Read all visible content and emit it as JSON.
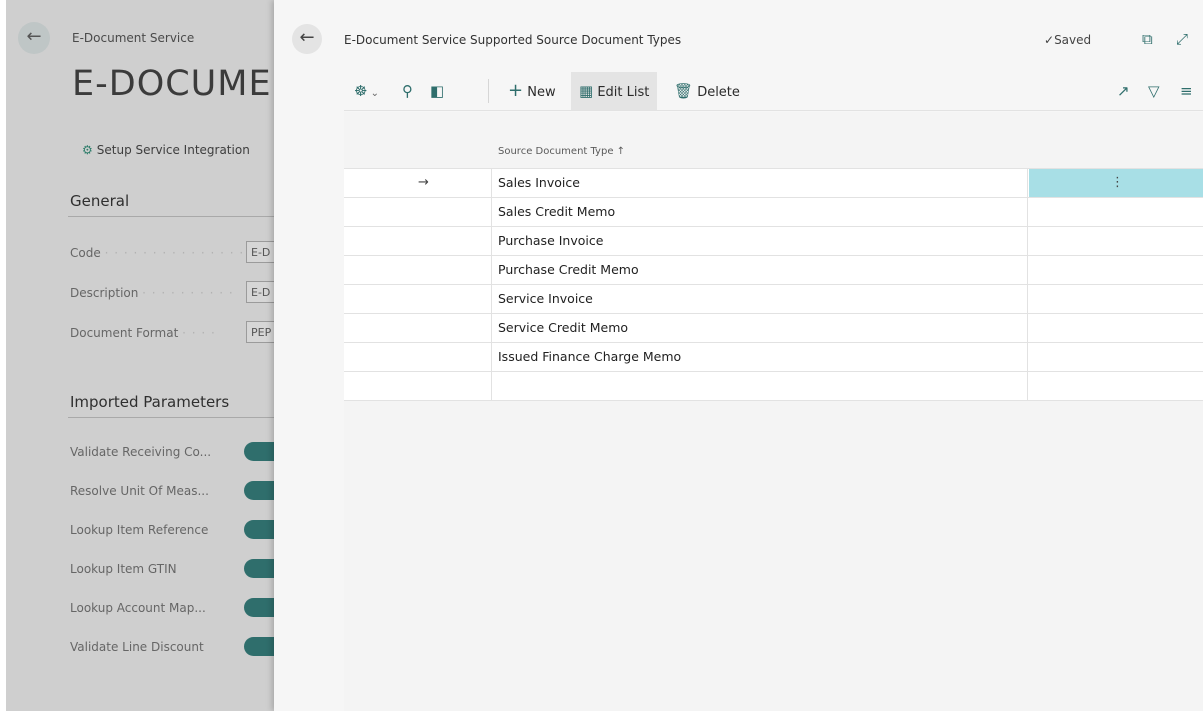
{
  "background": {
    "caption": "E-Document Service",
    "title": "E-DOCUME",
    "action": "Setup Service Integration",
    "sections": {
      "general": "General",
      "imported": "Imported Parameters"
    },
    "fields": [
      {
        "label": "Code",
        "value": "E-D"
      },
      {
        "label": "Description",
        "value": "E-D"
      },
      {
        "label": "Document Format",
        "value": "PEP"
      }
    ],
    "toggles": [
      "Validate Receiving Co...",
      "Resolve Unit Of Meas...",
      "Lookup Item Reference",
      "Lookup Item GTIN",
      "Lookup Account Map...",
      "Validate Line Discount"
    ]
  },
  "dialog": {
    "title": "E-Document Service Supported Source Document Types",
    "saved": "Saved",
    "toolbar": {
      "new": "New",
      "edit_list": "Edit List",
      "delete": "Delete"
    },
    "column_header": "Source Document Type",
    "rows": [
      "Sales Invoice",
      "Sales Credit Memo",
      "Purchase Invoice",
      "Purchase Credit Memo",
      "Service Invoice",
      "Service Credit Memo",
      "Issued Finance Charge Memo",
      ""
    ]
  }
}
